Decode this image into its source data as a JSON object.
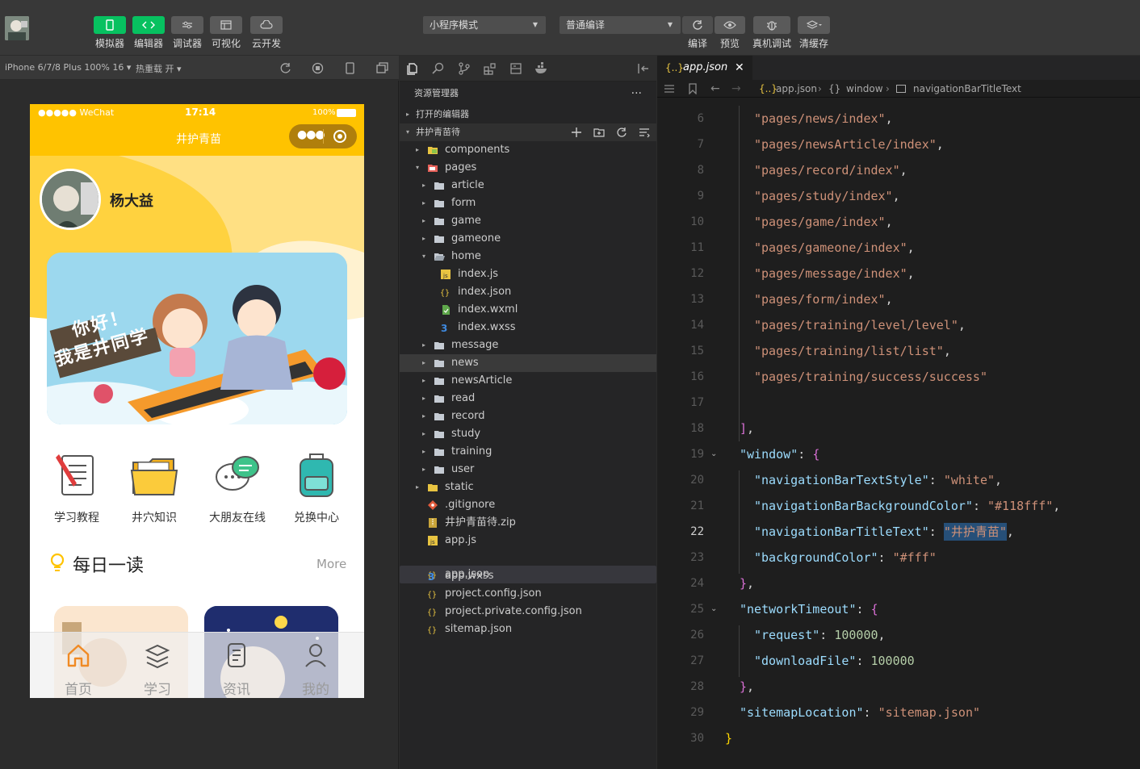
{
  "toolbar": {
    "buttons": [
      {
        "label": "模拟器"
      },
      {
        "label": "编辑器"
      },
      {
        "label": "调试器"
      },
      {
        "label": "可视化"
      },
      {
        "label": "云开发"
      }
    ],
    "mode_select": "小程序模式",
    "compile_select": "普通编译",
    "right_buttons": [
      {
        "label": "编译"
      },
      {
        "label": "预览"
      },
      {
        "label": "真机调试"
      },
      {
        "label": "清缓存"
      }
    ]
  },
  "subbar": {
    "device": "iPhone 6/7/8 Plus 100% 16 ▾",
    "hot_reload": "热重载 开 ▾"
  },
  "phone": {
    "status": {
      "carrier": "●●●●● WeChat",
      "time": "17:14",
      "battery": "100%"
    },
    "nav_title": "井护青苗",
    "user_name": "杨大益",
    "banner_text": [
      "你好！",
      "我是井同学"
    ],
    "menu": [
      {
        "label": "学习教程"
      },
      {
        "label": "井穴知识"
      },
      {
        "label": "大朋友在线"
      },
      {
        "label": "兑换中心"
      }
    ],
    "daily_title": "每日一读",
    "more": "More",
    "tabs": [
      {
        "label": "首页"
      },
      {
        "label": "学习"
      },
      {
        "label": "资讯"
      },
      {
        "label": "我的"
      }
    ]
  },
  "explorer": {
    "title": "资源管理器",
    "more": "···",
    "open_editors": "打开的编辑器",
    "project": "井护青苗待",
    "tree": [
      {
        "name": "components",
        "kind": "folder-special",
        "depth": 1,
        "twisty": "▸"
      },
      {
        "name": "pages",
        "kind": "folder-red",
        "depth": 1,
        "twisty": "▾"
      },
      {
        "name": "article",
        "kind": "folder",
        "depth": 2,
        "twisty": "▸"
      },
      {
        "name": "form",
        "kind": "folder",
        "depth": 2,
        "twisty": "▸"
      },
      {
        "name": "game",
        "kind": "folder",
        "depth": 2,
        "twisty": "▸"
      },
      {
        "name": "gameone",
        "kind": "folder",
        "depth": 2,
        "twisty": "▸"
      },
      {
        "name": "home",
        "kind": "folder-open",
        "depth": 2,
        "twisty": "▾"
      },
      {
        "name": "index.js",
        "kind": "js",
        "depth": 3,
        "twisty": ""
      },
      {
        "name": "index.json",
        "kind": "json",
        "depth": 3,
        "twisty": ""
      },
      {
        "name": "index.wxml",
        "kind": "wxml",
        "depth": 3,
        "twisty": ""
      },
      {
        "name": "index.wxss",
        "kind": "wxss",
        "depth": 3,
        "twisty": ""
      },
      {
        "name": "message",
        "kind": "folder",
        "depth": 2,
        "twisty": "▸"
      },
      {
        "name": "news",
        "kind": "folder",
        "depth": 2,
        "twisty": "▸",
        "hover": true
      },
      {
        "name": "newsArticle",
        "kind": "folder",
        "depth": 2,
        "twisty": "▸"
      },
      {
        "name": "read",
        "kind": "folder",
        "depth": 2,
        "twisty": "▸"
      },
      {
        "name": "record",
        "kind": "folder",
        "depth": 2,
        "twisty": "▸"
      },
      {
        "name": "study",
        "kind": "folder",
        "depth": 2,
        "twisty": "▸"
      },
      {
        "name": "training",
        "kind": "folder",
        "depth": 2,
        "twisty": "▸"
      },
      {
        "name": "user",
        "kind": "folder",
        "depth": 2,
        "twisty": "▸"
      },
      {
        "name": "static",
        "kind": "folder-yellow",
        "depth": 1,
        "twisty": "▸"
      },
      {
        "name": ".gitignore",
        "kind": "git",
        "depth": 1,
        "twisty": ""
      },
      {
        "name": "井护青苗待.zip",
        "kind": "zip",
        "depth": 1,
        "twisty": ""
      },
      {
        "name": "app.js",
        "kind": "js",
        "depth": 1,
        "twisty": ""
      },
      {
        "name": "app.json",
        "kind": "json",
        "depth": 1,
        "twisty": "",
        "selected": true
      },
      {
        "name": "app.wxss",
        "kind": "wxss",
        "depth": 1,
        "twisty": ""
      },
      {
        "name": "project.config.json",
        "kind": "json",
        "depth": 1,
        "twisty": ""
      },
      {
        "name": "project.private.config.json",
        "kind": "json",
        "depth": 1,
        "twisty": ""
      },
      {
        "name": "sitemap.json",
        "kind": "json",
        "depth": 1,
        "twisty": ""
      }
    ]
  },
  "editor": {
    "tab": "app.json",
    "breadcrumb": [
      "app.json",
      "window",
      "navigationBarTitleText"
    ],
    "current_line": 22,
    "lines": [
      {
        "n": 6,
        "indent": 2,
        "tokens": [
          [
            "s",
            "\"pages/news/index\""
          ],
          [
            "p",
            ","
          ]
        ]
      },
      {
        "n": 7,
        "indent": 2,
        "tokens": [
          [
            "s",
            "\"pages/newsArticle/index\""
          ],
          [
            "p",
            ","
          ]
        ]
      },
      {
        "n": 8,
        "indent": 2,
        "tokens": [
          [
            "s",
            "\"pages/record/index\""
          ],
          [
            "p",
            ","
          ]
        ]
      },
      {
        "n": 9,
        "indent": 2,
        "tokens": [
          [
            "s",
            "\"pages/study/index\""
          ],
          [
            "p",
            ","
          ]
        ]
      },
      {
        "n": 10,
        "indent": 2,
        "tokens": [
          [
            "s",
            "\"pages/game/index\""
          ],
          [
            "p",
            ","
          ]
        ]
      },
      {
        "n": 11,
        "indent": 2,
        "tokens": [
          [
            "s",
            "\"pages/gameone/index\""
          ],
          [
            "p",
            ","
          ]
        ]
      },
      {
        "n": 12,
        "indent": 2,
        "tokens": [
          [
            "s",
            "\"pages/message/index\""
          ],
          [
            "p",
            ","
          ]
        ]
      },
      {
        "n": 13,
        "indent": 2,
        "tokens": [
          [
            "s",
            "\"pages/form/index\""
          ],
          [
            "p",
            ","
          ]
        ]
      },
      {
        "n": 14,
        "indent": 2,
        "tokens": [
          [
            "s",
            "\"pages/training/level/level\""
          ],
          [
            "p",
            ","
          ]
        ]
      },
      {
        "n": 15,
        "indent": 2,
        "tokens": [
          [
            "s",
            "\"pages/training/list/list\""
          ],
          [
            "p",
            ","
          ]
        ]
      },
      {
        "n": 16,
        "indent": 2,
        "tokens": [
          [
            "s",
            "\"pages/training/success/success\""
          ]
        ]
      },
      {
        "n": 17,
        "indent": 2,
        "tokens": []
      },
      {
        "n": 18,
        "indent": 1,
        "tokens": [
          [
            "br2",
            "]"
          ],
          [
            "p",
            ","
          ]
        ]
      },
      {
        "n": 19,
        "indent": 1,
        "tokens": [
          [
            "k",
            "\"window\""
          ],
          [
            "p",
            ": "
          ],
          [
            "br2",
            "{"
          ]
        ],
        "fold": true
      },
      {
        "n": 20,
        "indent": 2,
        "tokens": [
          [
            "k",
            "\"navigationBarTextStyle\""
          ],
          [
            "p",
            ": "
          ],
          [
            "s",
            "\"white\""
          ],
          [
            "p",
            ","
          ]
        ]
      },
      {
        "n": 21,
        "indent": 2,
        "tokens": [
          [
            "k",
            "\"navigationBarBackgroundColor\""
          ],
          [
            "p",
            ": "
          ],
          [
            "s",
            "\"#118fff\""
          ],
          [
            "p",
            ","
          ]
        ]
      },
      {
        "n": 22,
        "indent": 2,
        "tokens": [
          [
            "k",
            "\"navigationBarTitleText\""
          ],
          [
            "p",
            ": "
          ],
          [
            "s",
            "\"井护青苗\""
          ],
          [
            "p",
            ","
          ]
        ]
      },
      {
        "n": 23,
        "indent": 2,
        "tokens": [
          [
            "k",
            "\"backgroundColor\""
          ],
          [
            "p",
            ": "
          ],
          [
            "s",
            "\"#fff\""
          ]
        ]
      },
      {
        "n": 24,
        "indent": 1,
        "tokens": [
          [
            "br2",
            "}"
          ],
          [
            "p",
            ","
          ]
        ]
      },
      {
        "n": 25,
        "indent": 1,
        "tokens": [
          [
            "k",
            "\"networkTimeout\""
          ],
          [
            "p",
            ": "
          ],
          [
            "br2",
            "{"
          ]
        ],
        "fold": true
      },
      {
        "n": 26,
        "indent": 2,
        "tokens": [
          [
            "k",
            "\"request\""
          ],
          [
            "p",
            ": "
          ],
          [
            "n",
            "100000"
          ],
          [
            "p",
            ","
          ]
        ]
      },
      {
        "n": 27,
        "indent": 2,
        "tokens": [
          [
            "k",
            "\"downloadFile\""
          ],
          [
            "p",
            ": "
          ],
          [
            "n",
            "100000"
          ]
        ]
      },
      {
        "n": 28,
        "indent": 1,
        "tokens": [
          [
            "br2",
            "}"
          ],
          [
            "p",
            ","
          ]
        ]
      },
      {
        "n": 29,
        "indent": 1,
        "tokens": [
          [
            "k",
            "\"sitemapLocation\""
          ],
          [
            "p",
            ": "
          ],
          [
            "s",
            "\"sitemap.json\""
          ]
        ]
      },
      {
        "n": 30,
        "indent": 0,
        "tokens": [
          [
            "br",
            "}"
          ]
        ]
      }
    ]
  },
  "colors": {
    "accent_green": "#07c160",
    "phone_nav_yellow": "#ffc300",
    "string_orange": "#ce9178",
    "key_blue": "#9cdcfe"
  }
}
